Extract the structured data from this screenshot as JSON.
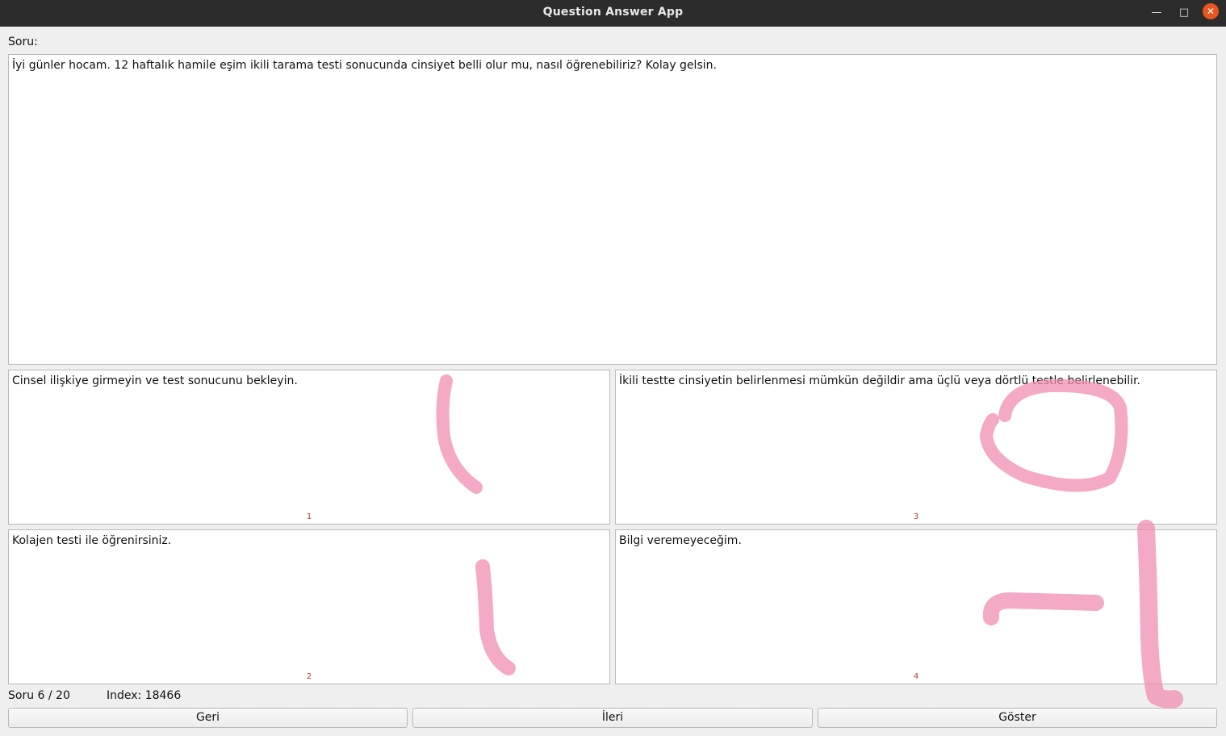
{
  "window": {
    "title": "Question Answer App"
  },
  "question": {
    "label": "Soru:",
    "text": "İyi günler hocam. 12 haftalık hamile eşim ikili tarama testi sonucunda cinsiyet belli olur mu, nasıl öğrenebiliriz? Kolay gelsin."
  },
  "answers": [
    {
      "text": "Cinsel ilişkiye girmeyin ve test sonucunu bekleyin.",
      "number": "1"
    },
    {
      "text": "Kolajen testi ile öğrenirsiniz.",
      "number": "2"
    },
    {
      "text": "İkili testte cinsiyetin belirlenmesi mümkün değildir ama üçlü veya dörtlü testle belirlenebilir.",
      "number": "3"
    },
    {
      "text": "Bilgi veremeyeceğim.",
      "number": "4"
    }
  ],
  "status": {
    "count": "Soru 6 / 20",
    "index": "Index: 18466"
  },
  "buttons": {
    "back": "Geri",
    "next": "İleri",
    "show": "Göster"
  },
  "annotation_color": "#f08cb2"
}
